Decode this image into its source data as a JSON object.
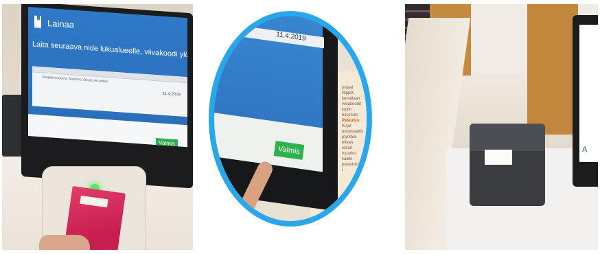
{
  "kiosk_screen": {
    "title": "Lainaa",
    "instruction": "Laita seuraava nide lukualueelle, viivakoodi ylöspäin",
    "item_text": "Sangdemnuumo, Mattano, David, Arcorttaa",
    "item_date": "11.4.2019",
    "done_button": "Valmis",
    "icon": "book-icon"
  },
  "zoom_view": {
    "date": "11.4.2019",
    "done_button": "Valmis",
    "sign_lines": [
      "prijaat",
      "Ripplit",
      "kerrallaan",
      "viivakoodit",
      "kuitin tulostumi"
    ],
    "sign_highlight": "Palautus:",
    "sign_lines_2": [
      "Kirjat automaattis",
      "ptyöläisi eltean",
      "rekari tuuarksi",
      "kaikki",
      "palautukselle i"
    ]
  },
  "printer_view": {
    "kiosk_fragment": "A"
  },
  "colors": {
    "screen_blue": "#2f79c8",
    "done_green": "#2fae4a",
    "oval_ring": "#2aa6ea",
    "book_red": "#c71e50"
  }
}
